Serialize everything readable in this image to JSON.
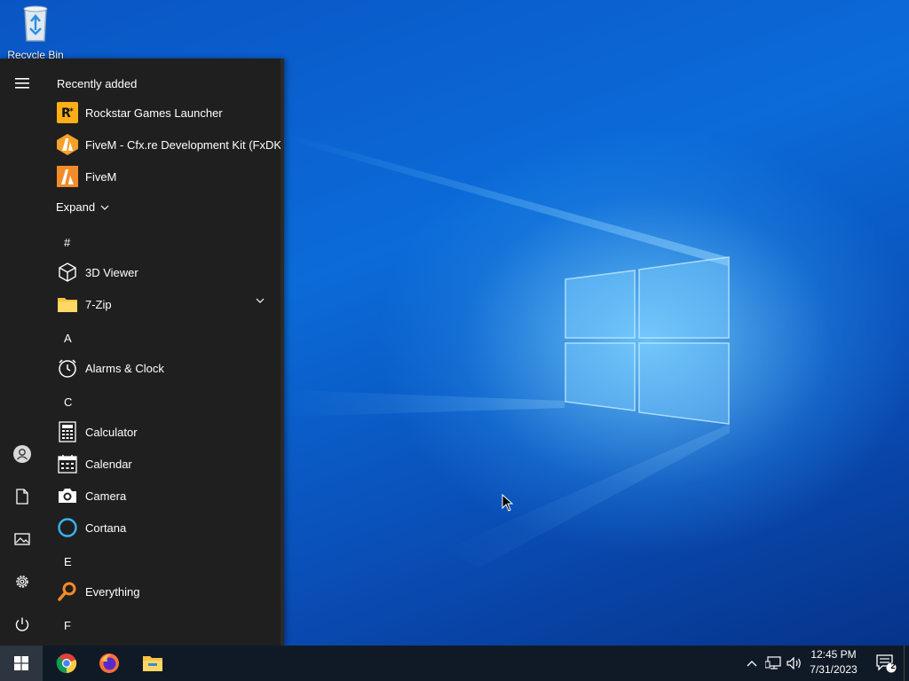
{
  "desktop": {
    "recycle_bin_label": "Recycle Bin"
  },
  "start_menu": {
    "recently_added_heading": "Recently added",
    "recent_apps": [
      {
        "name": "Rockstar Games Launcher",
        "icon": "rockstar-icon"
      },
      {
        "name": "FiveM - Cfx.re Development Kit (FxDK)",
        "icon": "fxdk-icon"
      },
      {
        "name": "FiveM",
        "icon": "fivem-icon"
      }
    ],
    "expand_label": "Expand",
    "groups": [
      {
        "letter": "#",
        "apps": [
          {
            "name": "3D Viewer",
            "icon": "cube-icon"
          },
          {
            "name": "7-Zip",
            "icon": "folder-icon",
            "expandable": true
          }
        ]
      },
      {
        "letter": "A",
        "apps": [
          {
            "name": "Alarms & Clock",
            "icon": "clock-icon"
          }
        ]
      },
      {
        "letter": "C",
        "apps": [
          {
            "name": "Calculator",
            "icon": "calculator-icon"
          },
          {
            "name": "Calendar",
            "icon": "calendar-icon"
          },
          {
            "name": "Camera",
            "icon": "camera-icon"
          },
          {
            "name": "Cortana",
            "icon": "cortana-icon"
          }
        ]
      },
      {
        "letter": "E",
        "apps": [
          {
            "name": "Everything",
            "icon": "search-icon"
          }
        ]
      },
      {
        "letter": "F",
        "apps": []
      }
    ],
    "rail_icons": [
      "hamburger-icon",
      "user-icon",
      "document-icon",
      "pictures-icon",
      "settings-icon",
      "power-icon"
    ]
  },
  "taskbar": {
    "pinned": [
      "chrome-icon",
      "firefox-icon",
      "file-explorer-icon"
    ],
    "clock_time": "12:45 PM",
    "clock_date": "7/31/2023",
    "notification_count": "2"
  },
  "colors": {
    "start_bg": "#1f1f1f",
    "taskbar_bg": "#101a26",
    "accent": "#0b6bd8"
  }
}
